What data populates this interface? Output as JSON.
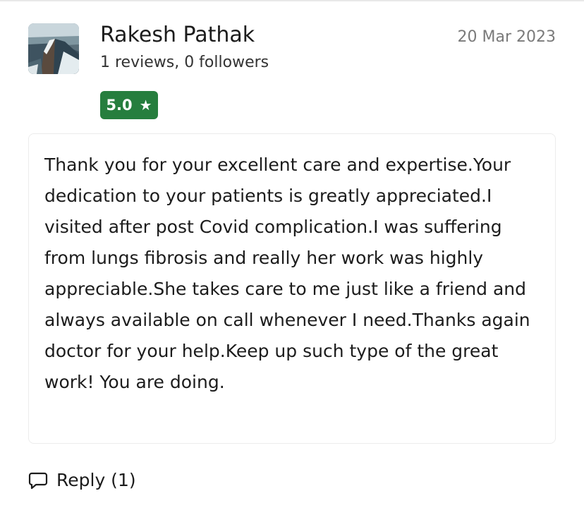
{
  "reviewer": {
    "name": "Rakesh Pathak",
    "stats": "1 reviews, 0 followers",
    "avatar_icon": "coastal-cliff-photo"
  },
  "review": {
    "date": "20 Mar 2023",
    "rating": "5.0",
    "rating_icon": "star-icon",
    "rating_color": "#267e3e",
    "text": "Thank you for your excellent care and expertise.Your dedication to your patients is greatly appreciated.I visited after post Covid complication.I was suffering from lungs fibrosis and really her work was highly appreciable.She takes care to me just like a friend and always available on call whenever I need.Thanks again doctor for your help.Keep up such type of the great work! You are doing."
  },
  "actions": {
    "reply_label": "Reply (1)",
    "reply_icon": "comment-icon"
  }
}
